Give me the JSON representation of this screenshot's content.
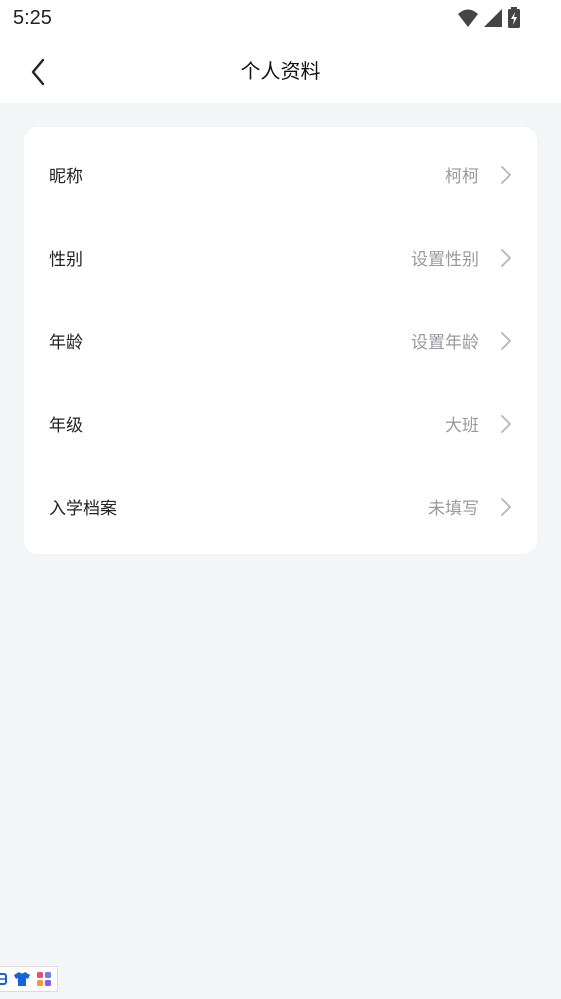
{
  "status_bar": {
    "time": "5:25",
    "icons": [
      "wifi-icon",
      "signal-icon",
      "battery-icon"
    ]
  },
  "header": {
    "title": "个人资料",
    "back_icon": "chevron-left-icon"
  },
  "profile": {
    "rows": [
      {
        "label": "昵称",
        "value": "柯柯"
      },
      {
        "label": "性别",
        "value": "设置性别"
      },
      {
        "label": "年龄",
        "value": "设置年龄"
      },
      {
        "label": "年级",
        "value": "大班"
      },
      {
        "label": "入学档案",
        "value": "未填写"
      }
    ]
  },
  "bottom_widget": {
    "icons": [
      "grid-icon",
      "shirt-icon",
      "apps-icon"
    ]
  },
  "colors": {
    "background": "#f4f5f7",
    "card": "#ffffff",
    "value_text": "#999aa0",
    "accent_blue": "#1565d8"
  }
}
